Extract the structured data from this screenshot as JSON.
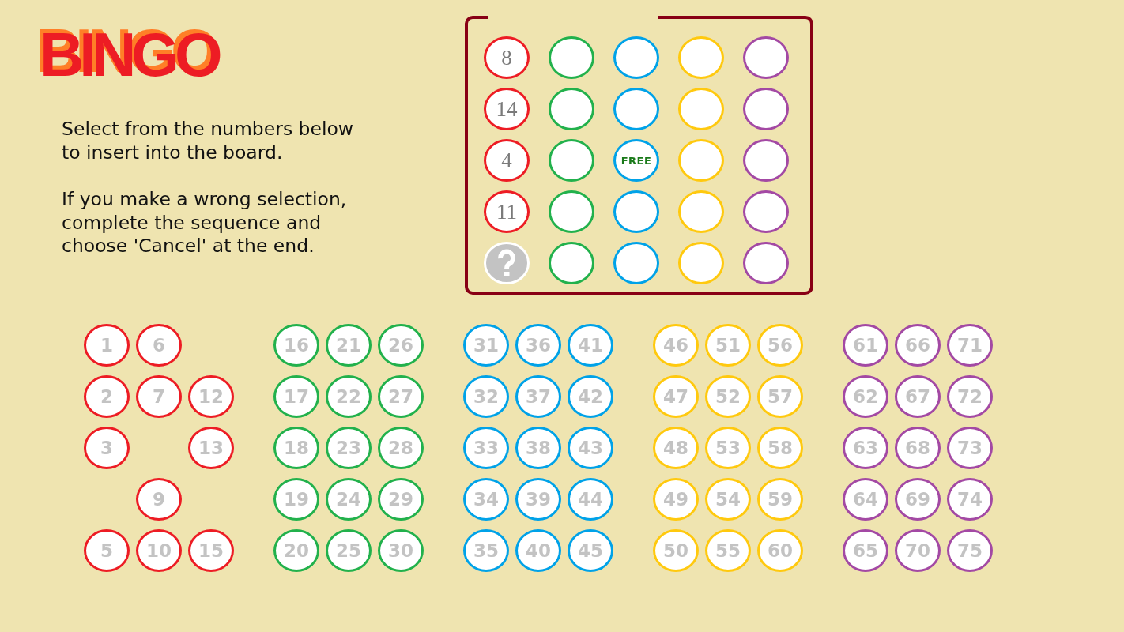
{
  "logo": {
    "text": "BINGO"
  },
  "instructions": [
    "Select from the numbers below to insert into the board.",
    "If you make a wrong selection, complete the sequence and choose 'Cancel' at the end."
  ],
  "board": {
    "columns": [
      {
        "color": "#ed1c24",
        "cells": [
          {
            "kind": "number",
            "text": "8"
          },
          {
            "kind": "number",
            "text": "14"
          },
          {
            "kind": "number",
            "text": "4"
          },
          {
            "kind": "number",
            "text": "11"
          },
          {
            "kind": "current"
          }
        ]
      },
      {
        "color": "#22b14c",
        "cells": [
          {
            "kind": "empty"
          },
          {
            "kind": "empty"
          },
          {
            "kind": "empty"
          },
          {
            "kind": "empty"
          },
          {
            "kind": "empty"
          }
        ]
      },
      {
        "color": "#00a2e8",
        "cells": [
          {
            "kind": "empty"
          },
          {
            "kind": "empty"
          },
          {
            "kind": "free",
            "text": "FREE"
          },
          {
            "kind": "empty"
          },
          {
            "kind": "empty"
          }
        ]
      },
      {
        "color": "#ffc90e",
        "cells": [
          {
            "kind": "empty"
          },
          {
            "kind": "empty"
          },
          {
            "kind": "empty"
          },
          {
            "kind": "empty"
          },
          {
            "kind": "empty"
          }
        ]
      },
      {
        "color": "#a349a4",
        "cells": [
          {
            "kind": "empty"
          },
          {
            "kind": "empty"
          },
          {
            "kind": "empty"
          },
          {
            "kind": "empty"
          },
          {
            "kind": "empty"
          }
        ]
      }
    ]
  },
  "pools": [
    {
      "color": "#ed1c24",
      "slots": [
        {
          "kind": "ball",
          "number": "1"
        },
        {
          "kind": "ball",
          "number": "2"
        },
        {
          "kind": "ball",
          "number": "3"
        },
        {
          "kind": "gap"
        },
        {
          "kind": "ball",
          "number": "5"
        },
        {
          "kind": "ball",
          "number": "6"
        },
        {
          "kind": "ball",
          "number": "7"
        },
        {
          "kind": "gap"
        },
        {
          "kind": "ball",
          "number": "9"
        },
        {
          "kind": "ball",
          "number": "10"
        },
        {
          "kind": "gap"
        },
        {
          "kind": "ball",
          "number": "12"
        },
        {
          "kind": "ball",
          "number": "13"
        },
        {
          "kind": "gap"
        },
        {
          "kind": "ball",
          "number": "15"
        }
      ]
    },
    {
      "color": "#22b14c",
      "slots": [
        {
          "kind": "ball",
          "number": "16"
        },
        {
          "kind": "ball",
          "number": "17"
        },
        {
          "kind": "ball",
          "number": "18"
        },
        {
          "kind": "ball",
          "number": "19"
        },
        {
          "kind": "ball",
          "number": "20"
        },
        {
          "kind": "ball",
          "number": "21"
        },
        {
          "kind": "ball",
          "number": "22"
        },
        {
          "kind": "ball",
          "number": "23"
        },
        {
          "kind": "ball",
          "number": "24"
        },
        {
          "kind": "ball",
          "number": "25"
        },
        {
          "kind": "ball",
          "number": "26"
        },
        {
          "kind": "ball",
          "number": "27"
        },
        {
          "kind": "ball",
          "number": "28"
        },
        {
          "kind": "ball",
          "number": "29"
        },
        {
          "kind": "ball",
          "number": "30"
        }
      ]
    },
    {
      "color": "#00a2e8",
      "slots": [
        {
          "kind": "ball",
          "number": "31"
        },
        {
          "kind": "ball",
          "number": "32"
        },
        {
          "kind": "ball",
          "number": "33"
        },
        {
          "kind": "ball",
          "number": "34"
        },
        {
          "kind": "ball",
          "number": "35"
        },
        {
          "kind": "ball",
          "number": "36"
        },
        {
          "kind": "ball",
          "number": "37"
        },
        {
          "kind": "ball",
          "number": "38"
        },
        {
          "kind": "ball",
          "number": "39"
        },
        {
          "kind": "ball",
          "number": "40"
        },
        {
          "kind": "ball",
          "number": "41"
        },
        {
          "kind": "ball",
          "number": "42"
        },
        {
          "kind": "ball",
          "number": "43"
        },
        {
          "kind": "ball",
          "number": "44"
        },
        {
          "kind": "ball",
          "number": "45"
        }
      ]
    },
    {
      "color": "#ffc90e",
      "slots": [
        {
          "kind": "ball",
          "number": "46"
        },
        {
          "kind": "ball",
          "number": "47"
        },
        {
          "kind": "ball",
          "number": "48"
        },
        {
          "kind": "ball",
          "number": "49"
        },
        {
          "kind": "ball",
          "number": "50"
        },
        {
          "kind": "ball",
          "number": "51"
        },
        {
          "kind": "ball",
          "number": "52"
        },
        {
          "kind": "ball",
          "number": "53"
        },
        {
          "kind": "ball",
          "number": "54"
        },
        {
          "kind": "ball",
          "number": "55"
        },
        {
          "kind": "ball",
          "number": "56"
        },
        {
          "kind": "ball",
          "number": "57"
        },
        {
          "kind": "ball",
          "number": "58"
        },
        {
          "kind": "ball",
          "number": "59"
        },
        {
          "kind": "ball",
          "number": "60"
        }
      ]
    },
    {
      "color": "#a349a4",
      "slots": [
        {
          "kind": "ball",
          "number": "61"
        },
        {
          "kind": "ball",
          "number": "62"
        },
        {
          "kind": "ball",
          "number": "63"
        },
        {
          "kind": "ball",
          "number": "64"
        },
        {
          "kind": "ball",
          "number": "65"
        },
        {
          "kind": "ball",
          "number": "66"
        },
        {
          "kind": "ball",
          "number": "67"
        },
        {
          "kind": "ball",
          "number": "68"
        },
        {
          "kind": "ball",
          "number": "69"
        },
        {
          "kind": "ball",
          "number": "70"
        },
        {
          "kind": "ball",
          "number": "71"
        },
        {
          "kind": "ball",
          "number": "72"
        },
        {
          "kind": "ball",
          "number": "73"
        },
        {
          "kind": "ball",
          "number": "74"
        },
        {
          "kind": "ball",
          "number": "75"
        }
      ]
    }
  ]
}
